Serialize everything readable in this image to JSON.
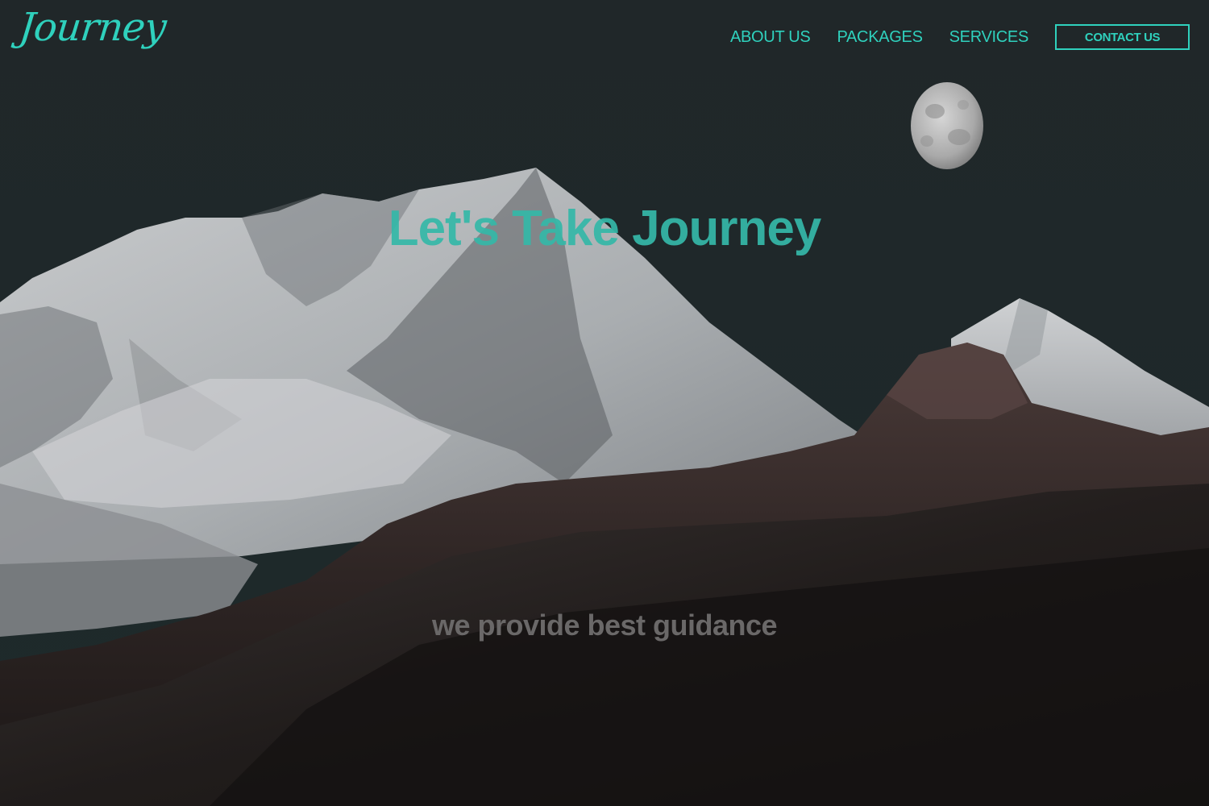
{
  "brand": {
    "logo_text": "Journey",
    "accent_color": "#2fd1bd"
  },
  "nav": {
    "items": [
      {
        "label": "ABOUT US"
      },
      {
        "label": "PACKAGES"
      },
      {
        "label": "SERVICES"
      }
    ],
    "contact_label": "CONTACT US"
  },
  "hero": {
    "title": "Let's Take Journey",
    "subtitle": "we provide best guidance",
    "background": "night mountain landscape with moon",
    "icons": [
      "moon-icon"
    ]
  }
}
